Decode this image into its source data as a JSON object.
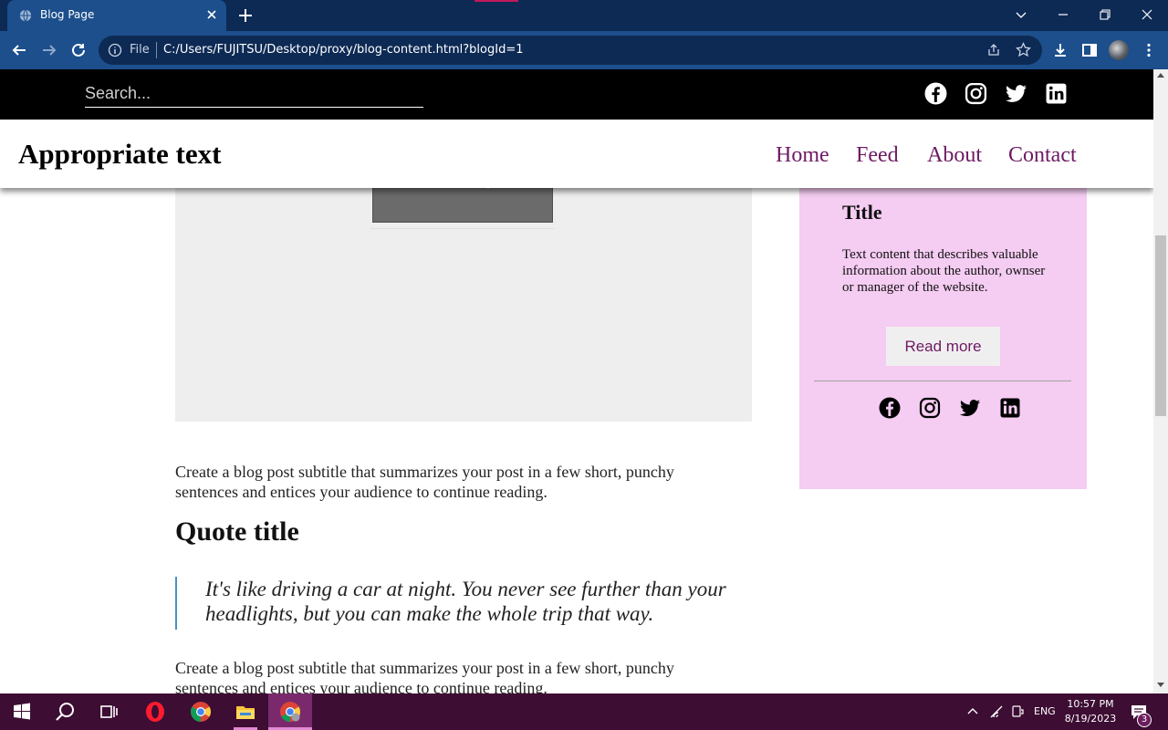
{
  "browser": {
    "tab_title": "Blog Page",
    "file_label": "File",
    "url": "C:/Users/FUJITSU/Desktop/proxy/blog-content.html?blogId=1"
  },
  "topbar": {
    "search_placeholder": "Search..."
  },
  "navbar": {
    "brand": "Appropriate text",
    "links": [
      "Home",
      "Feed",
      "About",
      "Contact"
    ]
  },
  "content": {
    "subtitle_1": "Create a blog post subtitle that summarizes your post in a few short, punchy sentences and entices your audience to continue reading.",
    "quote_title": "Quote title",
    "quote": "It's like driving a car at night. You never see further than your headlights, but you can make the whole trip that way.",
    "subtitle_2": "Create a blog post subtitle that summarizes your post in a few short, punchy sentences and entices your audience to continue reading."
  },
  "sidebar": {
    "title": "Title",
    "text": "Text content that describes valuable information about the author, ownser or manager of the website.",
    "button": "Read more"
  },
  "taskbar": {
    "language": "ENG",
    "time": "10:57 PM",
    "date": "8/19/2023",
    "notifications": "3"
  },
  "colors": {
    "accent": "#6d1a63",
    "sidebar_bg": "#f5ccf2",
    "taskbar_bg": "#3d0d33",
    "chrome_bg": "#1c4f8c"
  }
}
